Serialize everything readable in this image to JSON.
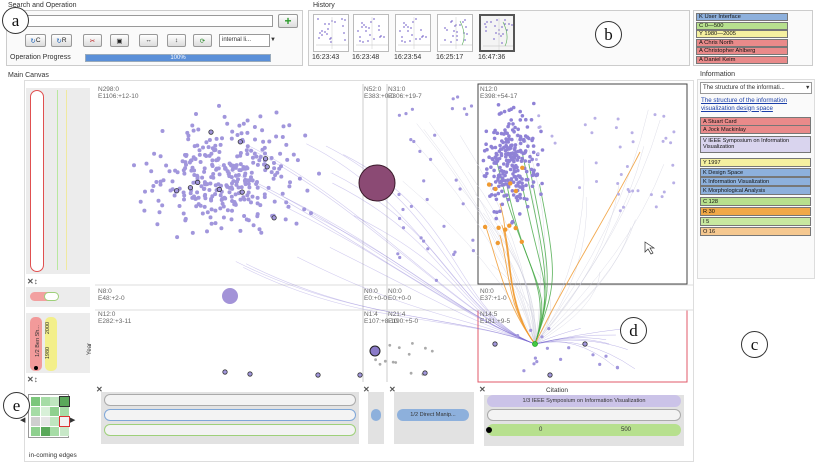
{
  "search": {
    "title": "Search and Operation",
    "input_value": "",
    "buttons": [
      "C",
      "R",
      "",
      "",
      "",
      "",
      ""
    ],
    "dropdown_value": "internal li...",
    "progress_label": "Operation Progress",
    "progress_value": "100%",
    "progress_fraction": 1.0
  },
  "history": {
    "title": "History",
    "times": [
      "16:23:43",
      "16:23:48",
      "16:23:54",
      "16:25:17",
      "16:47:36"
    ]
  },
  "callouts": {
    "a": "a",
    "b": "b",
    "c": "c",
    "d": "d",
    "e": "e"
  },
  "legend": {
    "chips": [
      {
        "label": "K  User Interface",
        "color": "#8db0dc"
      },
      {
        "label": "C  0—500",
        "color": "#b7e08e"
      },
      {
        "label": "Y  1980—2005",
        "color": "#f5f0a0"
      },
      {
        "label": "A  Chris North",
        "color": "#e98a8a"
      },
      {
        "label": "A  Christopher Ahlberg",
        "color": "#e98a8a"
      },
      {
        "label": "A  Daniel Keim",
        "color": "#e98a8a"
      }
    ]
  },
  "canvas": {
    "title": "Main Canvas",
    "axis_label": "Year",
    "mini_year_labels": [
      "1/2 Ben Sh...",
      "2000",
      "1980"
    ],
    "node_labels": [
      [
        "N298:0",
        "E1106:+12-10"
      ],
      [
        "N52:0",
        "E383:+0-0"
      ],
      [
        "N31:0",
        "E306:+19-7"
      ],
      [
        "N12:0",
        "E398:+54-17"
      ],
      [
        "N8:0",
        "E48:+2-0"
      ],
      [
        "N0:0",
        "E0:+0-0"
      ],
      [
        "N0:0",
        "E0:+0-0"
      ],
      [
        "N0:0",
        "E37:+1-0"
      ],
      [
        "N12:0",
        "E282:+3-11"
      ],
      [
        "N1:4",
        "E107:+8-10"
      ],
      [
        "N21:4",
        "E190:+5-0"
      ],
      [
        "N14:5",
        "E181:+9-5"
      ]
    ]
  },
  "filters": {
    "direct_manip": "1/2 Direct Manip...",
    "citation_title": "Citation",
    "citation_series": "1/3 IEEE Symposium on Information Visualization",
    "citation_min": "0",
    "citation_max": "500"
  },
  "edges_widget": {
    "label": "in-coming edges"
  },
  "information": {
    "title": "Information",
    "dropdown_value": "The structure of the informati...",
    "paper_title": "The structure of the information visualization design space",
    "chips": [
      {
        "label": "A  Stuart Card",
        "color": "#e98a8a"
      },
      {
        "label": "A  Jock Mackinlay",
        "color": "#e98a8a"
      },
      {
        "label": "V  IEEE Symposium on Information Visualization",
        "color": "#d9d4ee"
      },
      {
        "label": "Y  1997",
        "color": "#f5f0a0"
      },
      {
        "label": "K  Design Space",
        "color": "#8db0dc"
      },
      {
        "label": "K  Information Visualization",
        "color": "#8db0dc"
      },
      {
        "label": "K  Morphological Analysis",
        "color": "#8db0dc"
      },
      {
        "label": "C  128",
        "color": "#b7e08e"
      },
      {
        "label": "R  30",
        "color": "#f0a848"
      },
      {
        "label": "I  5",
        "color": "#c8e8a0"
      },
      {
        "label": "O  16",
        "color": "#f5c890"
      }
    ]
  }
}
